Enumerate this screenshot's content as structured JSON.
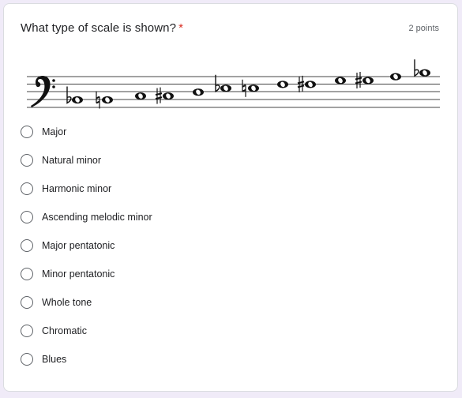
{
  "question": {
    "title": "What type of scale is shown?",
    "required_marker": "*",
    "points": "2 points"
  },
  "staff": {
    "clef": "bass-clef",
    "notes": [
      {
        "accidental": "flat",
        "step": 0
      },
      {
        "accidental": "natural",
        "step": 0
      },
      {
        "accidental": "",
        "step": 1
      },
      {
        "accidental": "sharp",
        "step": 1
      },
      {
        "accidental": "",
        "step": 2
      },
      {
        "accidental": "flat",
        "step": 3
      },
      {
        "accidental": "natural",
        "step": 3
      },
      {
        "accidental": "",
        "step": 4
      },
      {
        "accidental": "sharp",
        "step": 4
      },
      {
        "accidental": "",
        "step": 5
      },
      {
        "accidental": "sharp",
        "step": 5
      },
      {
        "accidental": "",
        "step": 6
      },
      {
        "accidental": "flat",
        "step": 7
      }
    ]
  },
  "options": [
    {
      "label": "Major",
      "selected": false
    },
    {
      "label": "Natural minor",
      "selected": false
    },
    {
      "label": "Harmonic minor",
      "selected": false
    },
    {
      "label": "Ascending melodic minor",
      "selected": false
    },
    {
      "label": "Major pentatonic",
      "selected": false
    },
    {
      "label": "Minor pentatonic",
      "selected": false
    },
    {
      "label": "Whole tone",
      "selected": false
    },
    {
      "label": "Chromatic",
      "selected": false
    },
    {
      "label": "Blues",
      "selected": false
    }
  ],
  "colors": {
    "background": "#f0ebf8",
    "required": "#d93025",
    "text": "#202124",
    "muted": "#5f6368"
  }
}
